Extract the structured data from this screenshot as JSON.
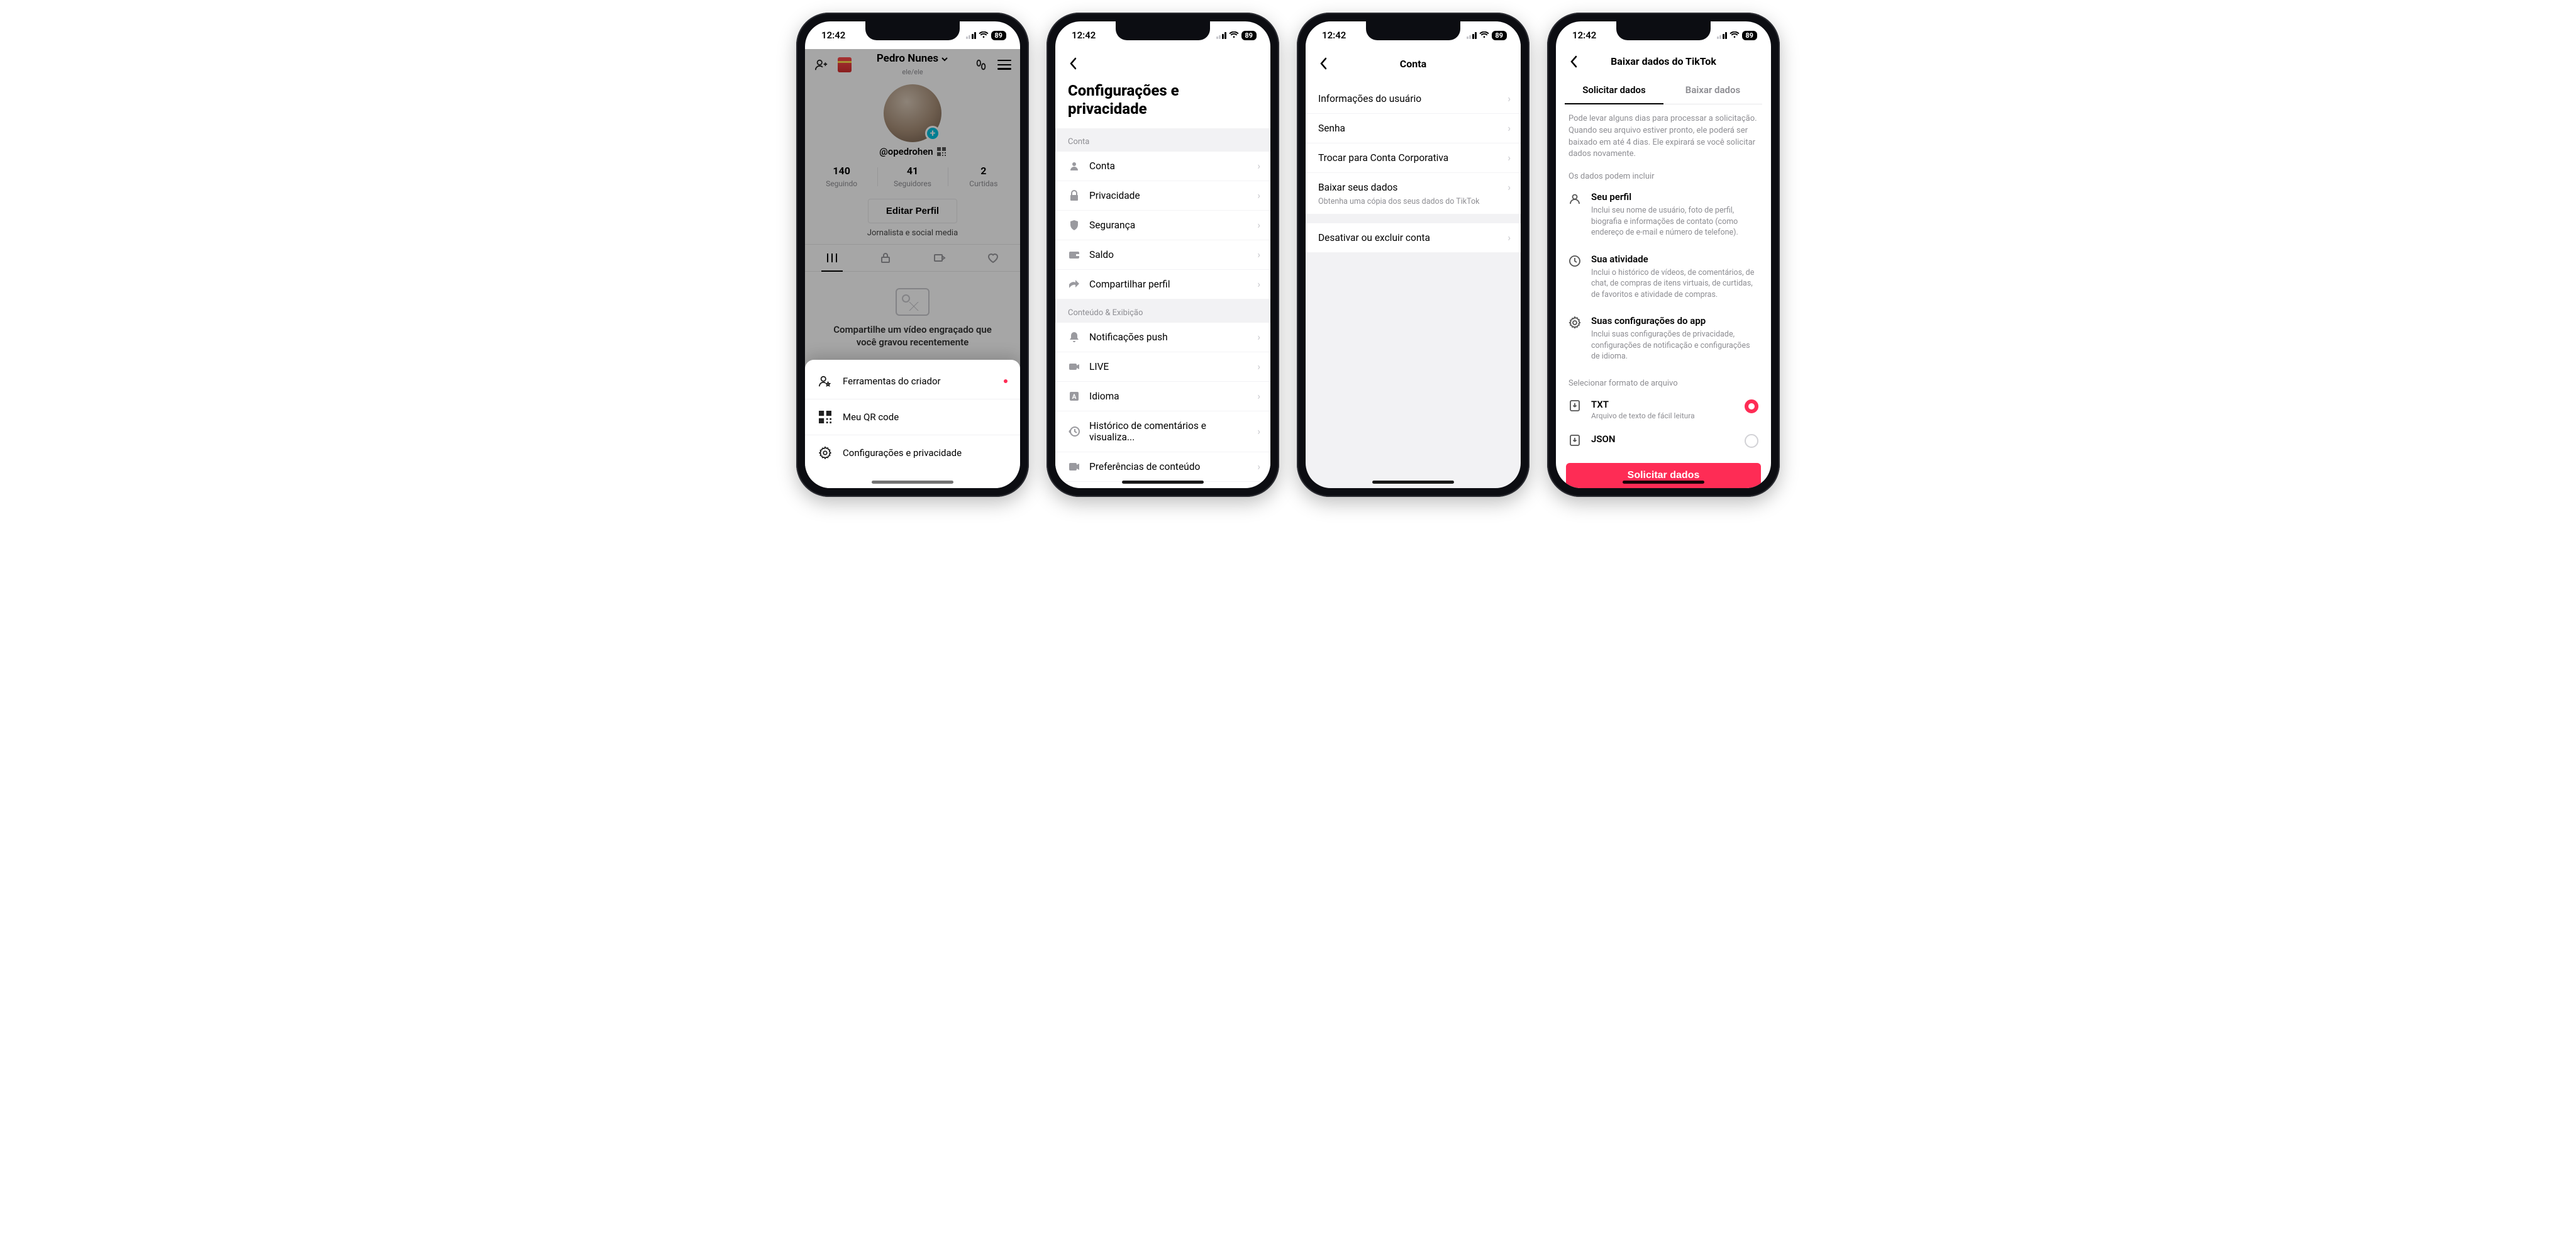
{
  "status": {
    "time": "12:42",
    "battery": "89"
  },
  "screen1": {
    "display_name": "Pedro Nunes",
    "pronouns": "ele/ele",
    "handle": "@opedrohen",
    "stats": {
      "following": {
        "value": "140",
        "label": "Seguindo"
      },
      "followers": {
        "value": "41",
        "label": "Seguidores"
      },
      "likes": {
        "value": "2",
        "label": "Curtidas"
      }
    },
    "edit_button": "Editar Perfil",
    "bio": "Jornalista e social media",
    "empty_state": "Compartilhe um vídeo engraçado que você gravou recentemente",
    "sheet": {
      "creator_tools": "Ferramentas do criador",
      "qr": "Meu QR code",
      "settings": "Configurações e privacidade"
    }
  },
  "screen2": {
    "title_line1": "Configurações e",
    "title_line2": "privacidade",
    "section_account": "Conta",
    "section_content": "Conteúdo & Exibição",
    "items": {
      "account": "Conta",
      "privacy": "Privacidade",
      "security": "Segurança",
      "balance": "Saldo",
      "share": "Compartilhar perfil",
      "push": "Notificações push",
      "live": "LIVE",
      "language": "Idioma",
      "history": "Histórico de comentários e visualiza...",
      "content_pref": "Preferências de conteúdo"
    }
  },
  "screen3": {
    "title": "Conta",
    "items": {
      "user_info": "Informações do usuário",
      "password": "Senha",
      "switch_business": "Trocar para Conta Corporativa",
      "download": "Baixar seus dados",
      "download_sub": "Obtenha uma cópia dos seus dados do TikTok",
      "deactivate": "Desativar ou excluir conta"
    }
  },
  "screen4": {
    "title": "Baixar dados do TikTok",
    "tabs": {
      "request": "Solicitar dados",
      "download": "Baixar dados"
    },
    "info": "Pode levar alguns dias para processar a solicitação. Quando seu arquivo estiver pronto, ele poderá ser baixado em até 4 dias. Ele expirará se você solicitar dados novamente.",
    "sub_include": "Os dados podem incluir",
    "include": {
      "profile_t": "Seu perfil",
      "profile_d": "Inclui seu nome de usuário, foto de perfil, biografia e informações de contato (como endereço de e-mail e número de telefone).",
      "activity_t": "Sua atividade",
      "activity_d": "Inclui o histórico de vídeos, de comentários, de chat, de compras de itens virtuais, de curtidas, de favoritos e atividade de compras.",
      "settings_t": "Suas configurações do app",
      "settings_d": "Inclui suas configurações de privacidade, configurações de notificação e configurações de idioma."
    },
    "sub_format": "Selecionar formato de arquivo",
    "formats": {
      "txt_t": "TXT",
      "txt_d": "Arquivo de texto de fácil leitura",
      "json_t": "JSON"
    },
    "cta": "Solicitar dados"
  }
}
